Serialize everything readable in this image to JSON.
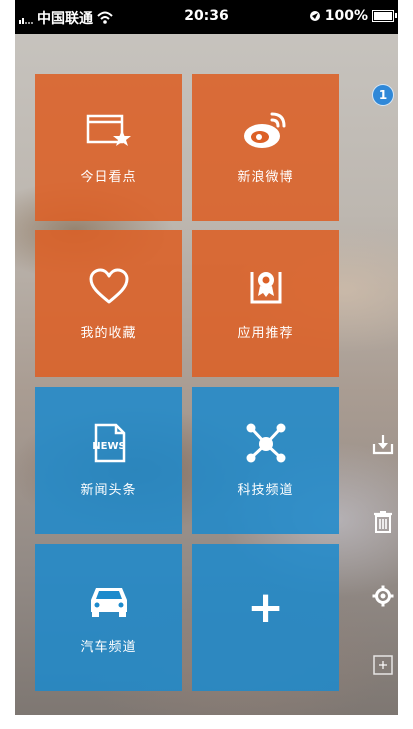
{
  "status_bar": {
    "carrier": "中国联通",
    "time": "20:36",
    "battery": "100%"
  },
  "tiles": [
    {
      "label": "今日看点",
      "icon": "today-highlights-icon"
    },
    {
      "label": "新浪微博",
      "icon": "weibo-icon"
    },
    {
      "label": "我的收藏",
      "icon": "heart-icon"
    },
    {
      "label": "应用推荐",
      "icon": "award-ribbon-icon"
    },
    {
      "label": "新闻头条",
      "icon": "news-icon"
    },
    {
      "label": "科技频道",
      "icon": "network-nodes-icon"
    },
    {
      "label": "汽车频道",
      "icon": "car-icon"
    },
    {
      "label": "+",
      "icon": "plus-icon"
    }
  ],
  "sidebar": {
    "badge_count": "1",
    "icons": [
      "download-icon",
      "trash-icon",
      "gear-icon",
      "add-square-icon"
    ]
  },
  "colors": {
    "orange_tile": "#dc6026",
    "blue_tile": "#1c8acc",
    "badge": "#2f88d8"
  }
}
